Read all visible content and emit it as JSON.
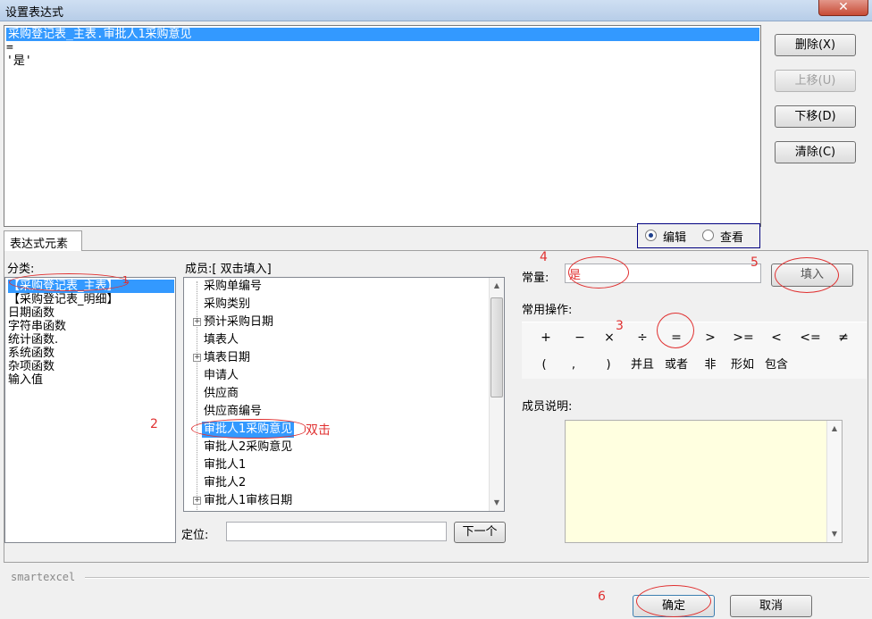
{
  "window": {
    "title": "设置表达式",
    "close_glyph": "✕"
  },
  "expression": {
    "lines": [
      "采购登记表_主表.审批人1采购意见",
      "=",
      "'是'"
    ],
    "selected_index": 0
  },
  "side_buttons": {
    "delete": "删除(X)",
    "move_up": "上移(U)",
    "move_down": "下移(D)",
    "clear": "清除(C)"
  },
  "mode": {
    "edit": "编辑",
    "view": "查看",
    "selected": "edit"
  },
  "tab_label": "表达式元素",
  "category": {
    "label": "分类:",
    "items": [
      "【采购登记表_主表】",
      "【采购登记表_明细】",
      "日期函数",
      "字符串函数",
      "统计函数.",
      "系统函数",
      "杂项函数",
      "输入值"
    ],
    "selected_index": 0
  },
  "members": {
    "label": "成员:[ 双击填入]",
    "items": [
      {
        "text": "采购单编号",
        "expandable": false
      },
      {
        "text": "采购类别",
        "expandable": false
      },
      {
        "text": "预计采购日期",
        "expandable": true
      },
      {
        "text": "填表人",
        "expandable": false
      },
      {
        "text": "填表日期",
        "expandable": true
      },
      {
        "text": "申请人",
        "expandable": false
      },
      {
        "text": "供应商",
        "expandable": false
      },
      {
        "text": "供应商编号",
        "expandable": false
      },
      {
        "text": "审批人1采购意见",
        "expandable": false
      },
      {
        "text": "审批人2采购意见",
        "expandable": false
      },
      {
        "text": "审批人1",
        "expandable": false
      },
      {
        "text": "审批人2",
        "expandable": false
      },
      {
        "text": "审批人1审核日期",
        "expandable": true
      }
    ],
    "selected_index": 8,
    "scroll_fraction": 0.0
  },
  "locate": {
    "label": "定位:",
    "value": "",
    "next_button": "下一个"
  },
  "constant": {
    "label": "常量:",
    "value": "是",
    "fill_button": "填入"
  },
  "operators": {
    "label": "常用操作:",
    "row1": [
      "+",
      "−",
      "×",
      "÷",
      "=",
      ">",
      ">=",
      "<",
      "<=",
      "≠"
    ],
    "row2": [
      "(",
      ",",
      ")",
      "并且",
      "或者",
      "非",
      "形如",
      "包含"
    ]
  },
  "member_desc": {
    "label": "成员说明:",
    "value": ""
  },
  "brand": "smartexcel",
  "footer": {
    "ok": "确定",
    "cancel": "取消"
  },
  "annotations": {
    "n1": "1",
    "n2": "2",
    "n3": "3",
    "n4": "4",
    "n5": "5",
    "n6": "6",
    "double_click": "双击",
    "color": "#e03030"
  }
}
